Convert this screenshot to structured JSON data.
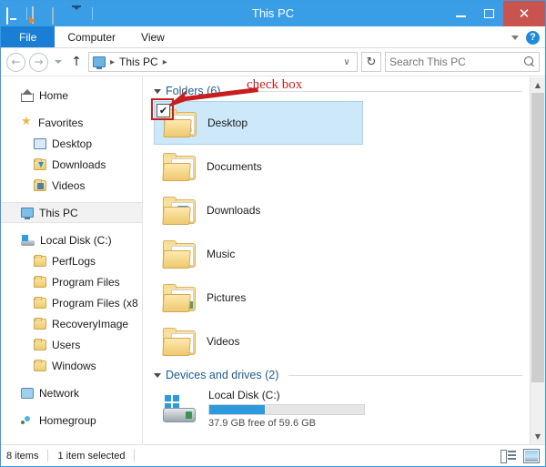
{
  "window": {
    "title": "This PC",
    "quick_access": [
      {
        "name": "this-pc-icon",
        "label": "This PC"
      },
      {
        "name": "properties-icon",
        "label": "Properties"
      },
      {
        "name": "new-folder-icon",
        "label": "New folder"
      },
      {
        "name": "customize-dropdown-icon",
        "label": "Customize Quick Access Toolbar"
      }
    ],
    "controls": {
      "minimize": "–",
      "maximize": "□",
      "close": "✕"
    }
  },
  "ribbon": {
    "tabs": [
      {
        "label": "File",
        "active": true
      },
      {
        "label": "Computer",
        "active": false
      },
      {
        "label": "View",
        "active": false
      }
    ],
    "collapse_label": "⌄",
    "help_label": "?"
  },
  "addressbar": {
    "back_glyph": "←",
    "forward_glyph": "→",
    "recent_label": "Recent locations",
    "up_glyph": "↑",
    "crumbs": [
      "This PC"
    ],
    "crumb_sep": "▸",
    "dropdown_glyph": "∨",
    "refresh_glyph": "↻",
    "search_placeholder": "Search This PC"
  },
  "sidebar": {
    "items": [
      {
        "label": "Home",
        "icon": "home-icon",
        "level": 1,
        "selected": false,
        "gap_before": false
      },
      {
        "label": "Favorites",
        "icon": "star-icon",
        "level": 1,
        "selected": false,
        "gap_before": true
      },
      {
        "label": "Desktop",
        "icon": "desktop-icon",
        "level": 2,
        "selected": false,
        "gap_before": false
      },
      {
        "label": "Downloads",
        "icon": "downloads-folder-icon",
        "level": 2,
        "selected": false,
        "gap_before": false
      },
      {
        "label": "Videos",
        "icon": "videos-folder-icon",
        "level": 2,
        "selected": false,
        "gap_before": false
      },
      {
        "label": "This PC",
        "icon": "this-pc-icon",
        "level": 1,
        "selected": true,
        "gap_before": true
      },
      {
        "label": "Local Disk (C:)",
        "icon": "drive-icon",
        "level": 1,
        "selected": false,
        "gap_before": true
      },
      {
        "label": "PerfLogs",
        "icon": "folder-icon",
        "level": 2,
        "selected": false,
        "gap_before": false
      },
      {
        "label": "Program Files",
        "icon": "folder-icon",
        "level": 2,
        "selected": false,
        "gap_before": false
      },
      {
        "label": "Program Files (x8",
        "icon": "folder-icon",
        "level": 2,
        "selected": false,
        "gap_before": false
      },
      {
        "label": "RecoveryImage",
        "icon": "folder-icon",
        "level": 2,
        "selected": false,
        "gap_before": false
      },
      {
        "label": "Users",
        "icon": "folder-icon",
        "level": 2,
        "selected": false,
        "gap_before": false
      },
      {
        "label": "Windows",
        "icon": "folder-icon",
        "level": 2,
        "selected": false,
        "gap_before": false
      },
      {
        "label": "Network",
        "icon": "network-icon",
        "level": 1,
        "selected": false,
        "gap_before": true
      },
      {
        "label": "Homegroup",
        "icon": "homegroup-icon",
        "level": 1,
        "selected": false,
        "gap_before": true
      }
    ]
  },
  "content": {
    "folders_group": {
      "title": "Folders (6)",
      "items": [
        {
          "label": "Desktop",
          "icon": "desktop-folder-icon",
          "selected": true,
          "checked": true
        },
        {
          "label": "Documents",
          "icon": "documents-folder-icon",
          "selected": false,
          "checked": false
        },
        {
          "label": "Downloads",
          "icon": "downloads-folder-icon",
          "selected": false,
          "checked": false
        },
        {
          "label": "Music",
          "icon": "music-folder-icon",
          "selected": false,
          "checked": false
        },
        {
          "label": "Pictures",
          "icon": "pictures-folder-icon",
          "selected": false,
          "checked": false
        },
        {
          "label": "Videos",
          "icon": "videos-folder-icon",
          "selected": false,
          "checked": false
        }
      ],
      "checkmark": "✔"
    },
    "devices_group": {
      "title": "Devices and drives (2)",
      "items": [
        {
          "label": "Local Disk (C:)",
          "icon": "local-disk-icon",
          "capacity_text": "37.9 GB free of 59.6 GB",
          "used_percent": 36
        }
      ]
    }
  },
  "annotation": {
    "text": "check box",
    "color": "#c81e1e"
  },
  "statusbar": {
    "item_count": "8 items",
    "selection": "1 item selected",
    "views": [
      {
        "name": "details-view-button",
        "active": false
      },
      {
        "name": "large-icons-view-button",
        "active": true
      }
    ]
  },
  "colors": {
    "title_bar": "#3a9ee6",
    "file_tab": "#1a7fd4",
    "close_button": "#c9544f",
    "selection": "#cde8f9",
    "group_header": "#1f5c8b",
    "progress": "#2e9ade",
    "annotation": "#c81e1e"
  }
}
